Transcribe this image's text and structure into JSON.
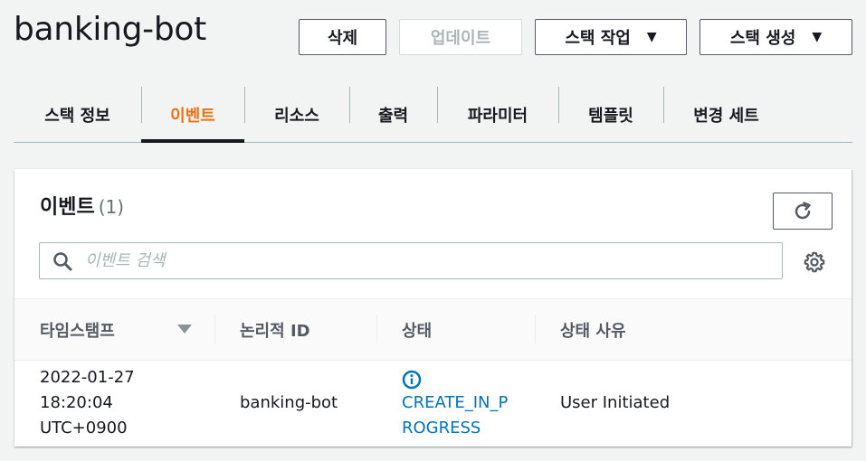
{
  "header": {
    "title": "banking-bot",
    "buttons": {
      "delete": "삭제",
      "update": "업데이트",
      "stack_actions": "스택 작업",
      "create_stack": "스택 생성"
    }
  },
  "tabs": [
    {
      "label": "스택 정보",
      "active": false
    },
    {
      "label": "이벤트",
      "active": true
    },
    {
      "label": "리소스",
      "active": false
    },
    {
      "label": "출력",
      "active": false
    },
    {
      "label": "파라미터",
      "active": false
    },
    {
      "label": "템플릿",
      "active": false
    },
    {
      "label": "변경 세트",
      "active": false
    }
  ],
  "events_panel": {
    "title": "이벤트",
    "count": "(1)",
    "search_placeholder": "이벤트 검색",
    "columns": {
      "timestamp": "타임스탬프",
      "logical_id": "논리적 ID",
      "status": "상태",
      "status_reason": "상태 사유"
    },
    "rows": [
      {
        "timestamp_date": "2022-01-27",
        "timestamp_time": "18:20:04",
        "timestamp_tz": "UTC+0900",
        "logical_id": "banking-bot",
        "status_line1": "CREATE_IN_P",
        "status_line2": "ROGRESS",
        "status_reason": "User Initiated"
      }
    ]
  },
  "colors": {
    "accent_active_tab": "#ec7211",
    "link": "#0073bb",
    "info_icon": "#0073bb"
  },
  "icons": [
    "caret-down-icon",
    "refresh-icon",
    "search-icon",
    "gear-icon",
    "sort-down-icon",
    "info-icon"
  ]
}
